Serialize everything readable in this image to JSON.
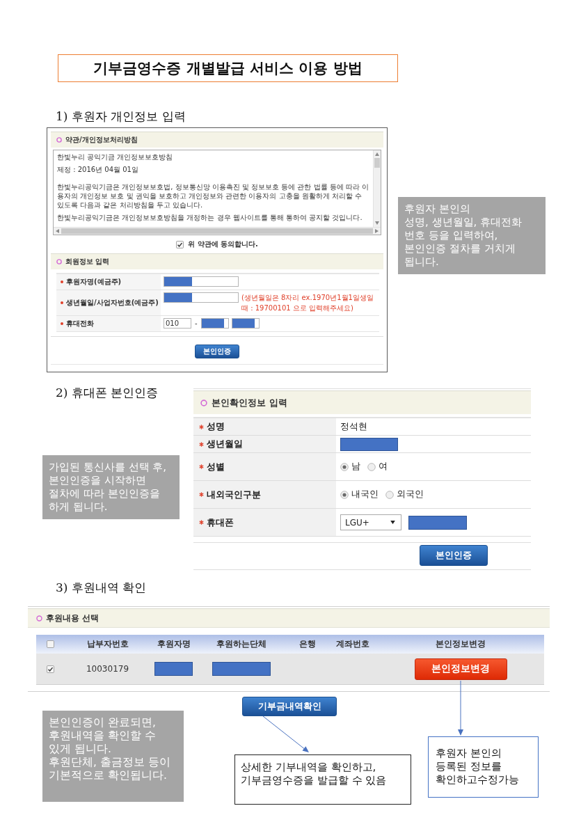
{
  "title": "기부금영수증 개별발급 서비스 이용 방법",
  "step_1": {
    "heading": "1) 후원자 개인정보 입력",
    "screen": {
      "terms": {
        "title": "약관/개인정보처리방침",
        "paragraphs": [
          "한빛누리 공익기금 개인정보보호방침",
          "제정 : 2016년 04월 01일",
          "한빛누리공익기금은 개인정보보호법, 정보통신망 이용촉진 및 정보보호 등에 관한 법률 등에 따라 이용자의 개인정보 보호 및 권익을 보호하고 개인정보와 관련한 이용자의 고충을 원활하게 처리할 수 있도록 다음과 같은 처리방침을 두고 있습니다.",
          "한빛누리공익기금은 개인정보보호방침을 개정하는 경우 웹사이트를 통해 통하여 공지할 것입니다."
        ]
      },
      "agree": {
        "label": "위 약관에 동의합니다.",
        "checked": true
      },
      "member": {
        "title": "회원정보 입력",
        "fields": [
          {
            "kind": "text",
            "label": "후원자명(예금주)",
            "redacted": true
          },
          {
            "kind": "text",
            "label": "생년월일/사업자번호(예금주)",
            "redacted": true,
            "hint": "(생년월일은 8자리 ex.1970년1월1일생일때 : 19700101 으로 입력해주세요)"
          },
          {
            "kind": "phone",
            "label": "휴대전화",
            "parts": [
              {
                "value": "010",
                "suffix": "-"
              },
              {
                "redacted": true
              },
              {
                "redacted": true
              }
            ]
          }
        ]
      },
      "button": "본인인증"
    },
    "note": "후원자 본인의\n성명, 생년월일, 휴대전화\n번호 등을 입력하여,\n본인인증 절차를 거치게\n됩니다."
  },
  "step_2": {
    "heading": "2) 휴대폰 본인인증",
    "screen": {
      "title": "본인확인정보 입력",
      "rows": [
        {
          "kind": "text",
          "label": "성명",
          "value": "정석현"
        },
        {
          "kind": "text",
          "label": "생년월일",
          "redacted": true
        },
        {
          "kind": "radio",
          "label": "성별",
          "options": [
            {
              "label": "남",
              "selected": true
            },
            {
              "label": "여",
              "selected": false
            }
          ]
        },
        {
          "kind": "radio",
          "label": "내외국인구분",
          "options": [
            {
              "label": "내국인",
              "selected": true
            },
            {
              "label": "외국인",
              "selected": false
            }
          ]
        },
        {
          "kind": "phone",
          "label": "휴대폰",
          "carrier": "LGU+",
          "redacted": true
        }
      ],
      "button": "본인인증"
    },
    "note": "가입된 통신사를 선택 후,\n본인인증을 시작하면\n절차에 따라 본인인증을\n하게 됩니다."
  },
  "step_3": {
    "heading": "3) 후원내역 확인",
    "screen": {
      "title": "후원내용 선택",
      "select_all_checked": false,
      "columns": [
        "납부자번호",
        "후원자명",
        "후원하는단체",
        "은행",
        "계좌번호",
        "본인정보변경"
      ],
      "rows": [
        {
          "checked": true,
          "cells": [
            {
              "kind": "text",
              "text": "10030179"
            },
            {
              "kind": "redacted"
            },
            {
              "kind": "redacted"
            },
            {
              "kind": "blank"
            },
            {
              "kind": "blank"
            },
            {
              "kind": "button",
              "text": "본인정보변경"
            }
          ]
        }
      ]
    },
    "button": "기부금내역확인",
    "note": "본인인증이 완료되면,\n후원내역을 확인할 수\n있게 됩니다.\n후원단체, 출금정보 등이\n기본적으로 확인됩니다.",
    "callouts": [
      {
        "text": "상세한 기부내역을 확인하고,\n기부금영수증을 발급할 수 있음",
        "color": "#222222"
      },
      {
        "text": "후원자 본인의\n등록된 정보를\n확인하고수정가능",
        "color": "#4472c4"
      }
    ]
  }
}
